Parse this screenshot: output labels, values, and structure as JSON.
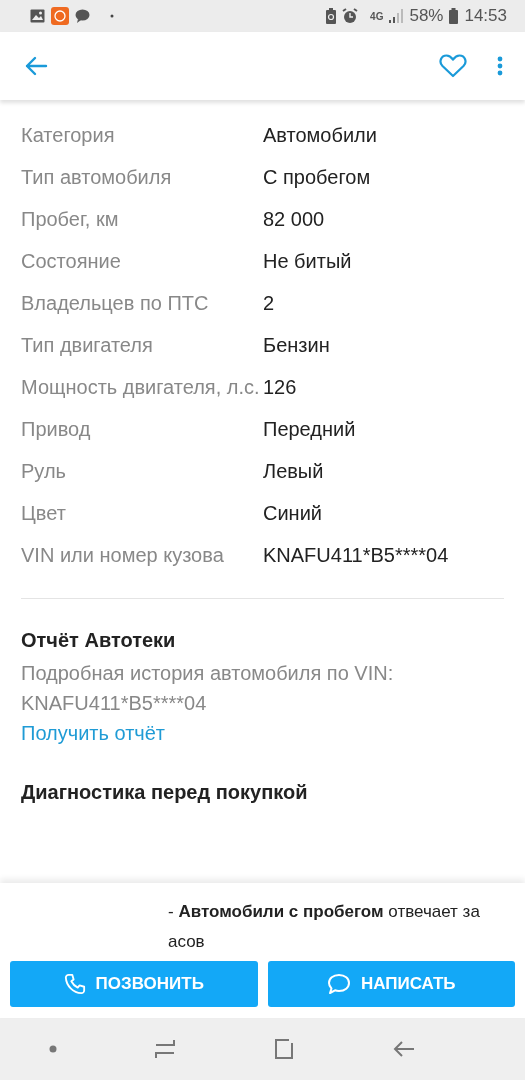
{
  "status_bar": {
    "network": "4G",
    "battery": "58%",
    "time": "14:53"
  },
  "header": {
    "favorite": false
  },
  "specs": [
    {
      "label": "Категория",
      "value": "Автомобили"
    },
    {
      "label": "Тип автомобиля",
      "value": "С пробегом"
    },
    {
      "label": "Пробег, км",
      "value": "82 000"
    },
    {
      "label": "Состояние",
      "value": "Не битый"
    },
    {
      "label": "Владельцев по ПТС",
      "value": "2"
    },
    {
      "label": "Тип двигателя",
      "value": "Бензин"
    },
    {
      "label": "Мощность двигателя, л.с.",
      "value": "126"
    },
    {
      "label": "Привод",
      "value": "Передний"
    },
    {
      "label": "Руль",
      "value": "Левый"
    },
    {
      "label": "Цвет",
      "value": "Синий"
    },
    {
      "label": "VIN или номер кузова",
      "value": "KNAFU411*B5****04"
    }
  ],
  "report": {
    "title": "Отчёт Автотеки",
    "description": "Подробная история автомобиля по VIN: KNAFU411*B5****04",
    "link": "Получить отчёт"
  },
  "next_section": {
    "title": "Диагностика перед покупкой"
  },
  "seller_note": "- **Автомобили с пробегом** отвечает за асов",
  "buttons": [
    {
      "kind": "call",
      "label": "ПОЗВОНИТЬ"
    },
    {
      "kind": "message",
      "label": "НАПИСАТЬ"
    }
  ]
}
